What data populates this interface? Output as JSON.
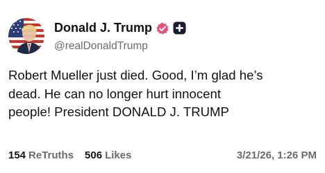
{
  "author": {
    "display_name": "Donald J. Trump",
    "handle": "@realDonaldTrump",
    "verified_icon": "verified-badge-icon",
    "extra_icon": "plus-badge-icon",
    "verified_color": "#e0527a"
  },
  "post": {
    "text": "Robert Mueller just died. Good, I’m glad he’s\ndead. He can no longer hurt innocent\npeople! President DONALD J. TRUMP"
  },
  "stats": {
    "retruths_count": "154",
    "retruths_label": "ReTruths",
    "likes_count": "506",
    "likes_label": "Likes",
    "timestamp": "3/21/26, 1:26 PM"
  }
}
